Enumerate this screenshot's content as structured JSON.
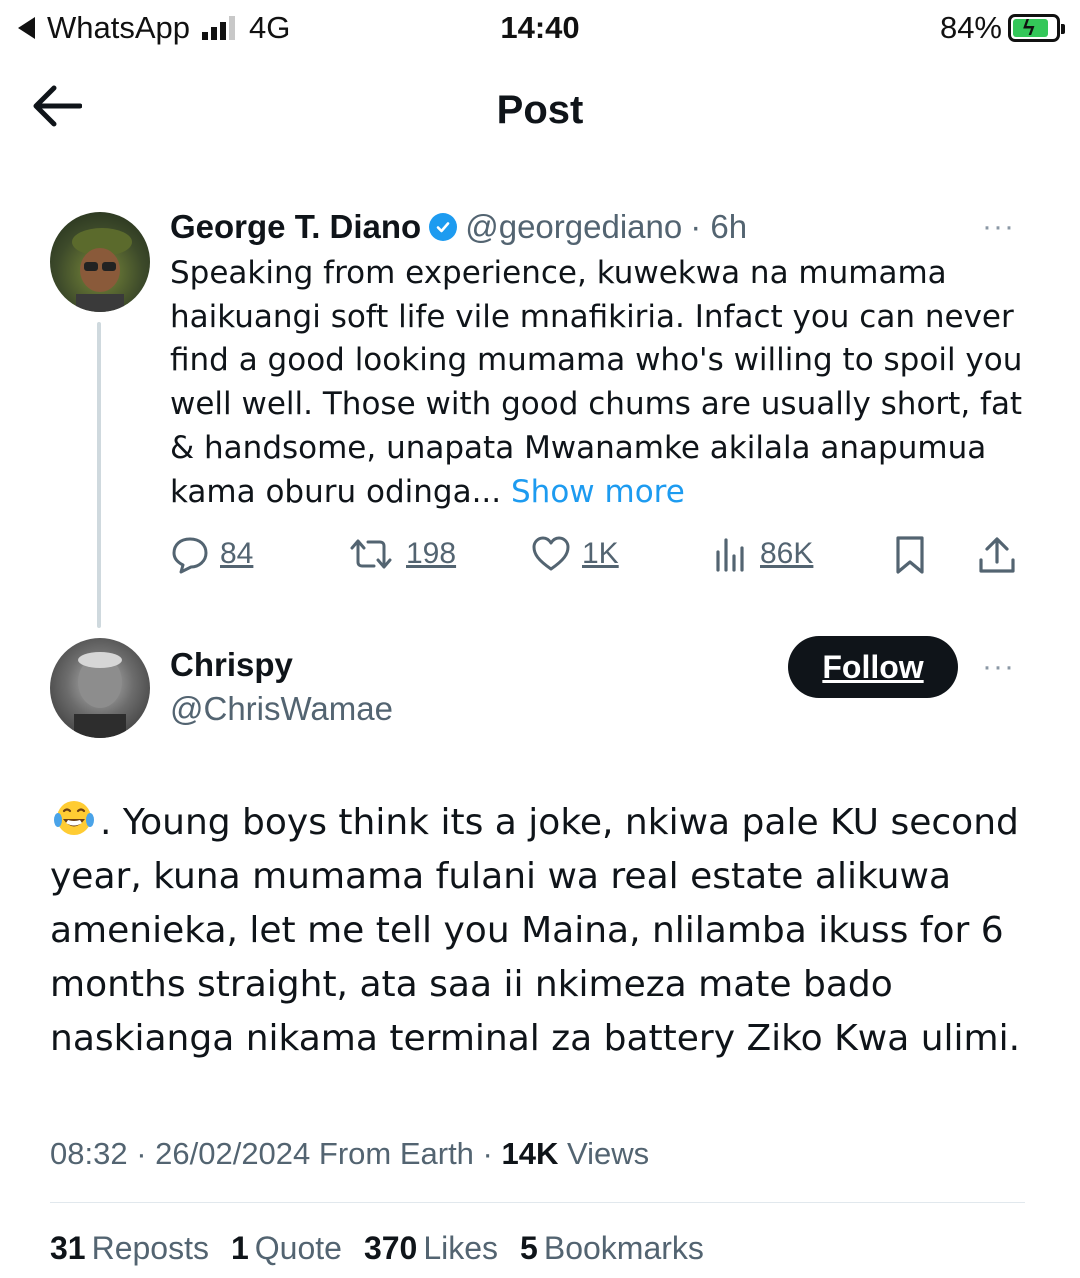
{
  "status_bar": {
    "back_app": "WhatsApp",
    "network": "4G",
    "time": "14:40",
    "battery_percent": "84%",
    "battery_level": 0.84
  },
  "header": {
    "title": "Post"
  },
  "original_tweet": {
    "name": "George T. Diano",
    "handle": "@georgediano",
    "time": "· 6h",
    "more": "···",
    "text": "Speaking from experience, kuwekwa na mumama haikuangi soft life vile mnafikiria. Infact you can never find a good looking mumama who's willing to spoil you well well. Those with good chums are usually short, fat & handsome, unapata Mwanamke akilala anapumua kama oburu odinga...",
    "show_more": "Show more",
    "actions": {
      "replies": "84",
      "reposts": "198",
      "likes": "1K",
      "views": "86K"
    }
  },
  "reply": {
    "name": "Chrispy",
    "handle": "@ChrisWamae",
    "follow_label": "Follow",
    "more": "···",
    "text": ". Young boys think its a joke, nkiwa pale KU second year, kuna mumama fulani wa real estate alikuwa amenieka, let me tell you Maina, nlilamba ikuss for 6 months straight, ata saa ii nkimeza mate bado naskianga nikama terminal za battery Ziko Kwa ulimi.",
    "emoji": "face-with-tears-of-joy",
    "timestamp": "08:32 · 26/02/2024 From Earth · ",
    "views_count": "14K",
    "views_label": "Views",
    "stats": [
      {
        "count": "31",
        "label": "Reposts"
      },
      {
        "count": "1",
        "label": "Quote"
      },
      {
        "count": "370",
        "label": "Likes"
      },
      {
        "count": "5",
        "label": "Bookmarks"
      }
    ]
  },
  "colors": {
    "accent": "#1d9bf0",
    "text_primary": "#0f1419",
    "text_secondary": "#536471",
    "battery_fill": "#34c759"
  }
}
